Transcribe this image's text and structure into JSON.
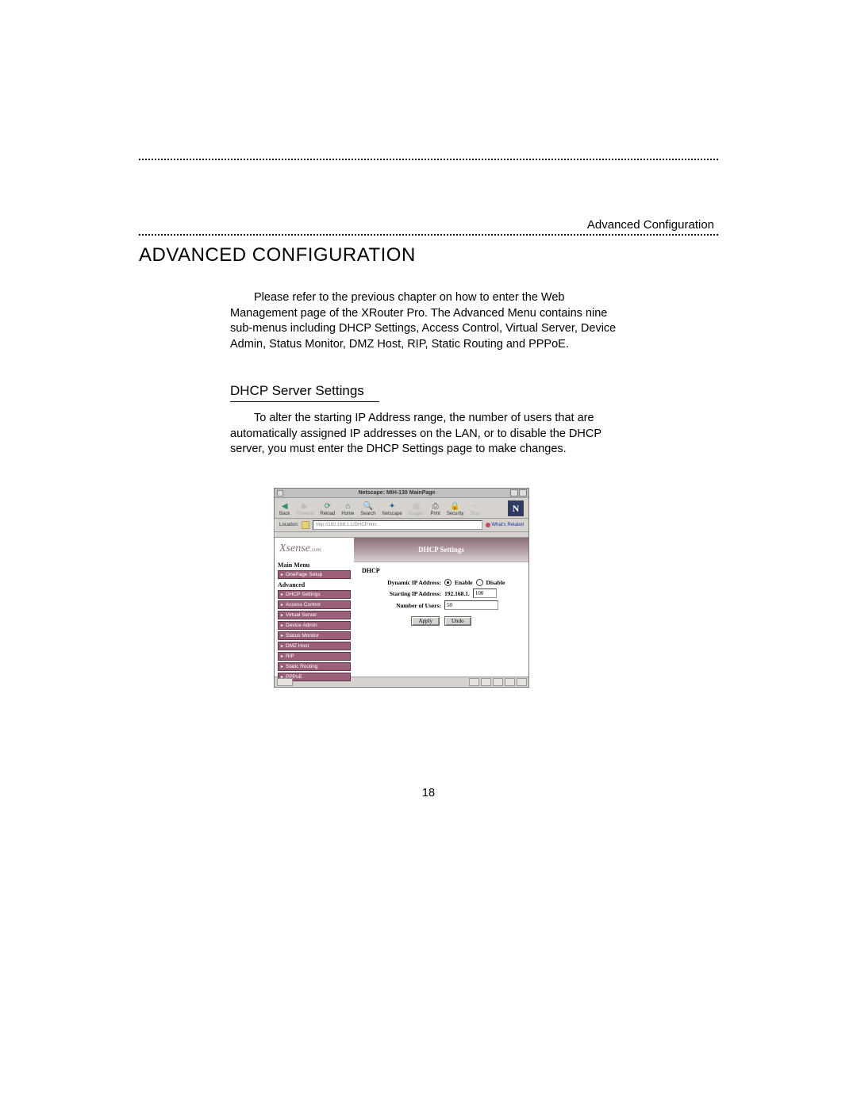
{
  "running_header": "Advanced Configuration",
  "chapter_title": "ADVANCED CONFIGURATION",
  "intro_paragraph": "Please refer to the previous chapter on how to enter the Web Management page of the XRouter Pro. The Advanced Menu contains nine sub-menus including DHCP Settings, Access Control, Virtual Server, Device Admin,  Status Monitor, DMZ Host, RIP, Static Routing and PPPoE.",
  "section_heading": "DHCP Server Settings",
  "section_paragraph": "To alter the starting IP Address range, the number of users that are automatically assigned IP addresses on the LAN, or to disable the DHCP server,  you must enter the DHCP Settings page to make changes.",
  "page_number": "18",
  "netscape": {
    "window_title": "Netscape: MIH-130 MainPage",
    "toolbar": {
      "back": "Back",
      "forward": "Forward",
      "reload": "Reload",
      "home": "Home",
      "search": "Search",
      "netscape": "Netscape",
      "images": "Images",
      "print": "Print",
      "security": "Security",
      "stop": "Stop"
    },
    "location_label": "Location:",
    "location_value": "http://192.168.1.1/DHCP.htm",
    "whats_related": "What's Related",
    "brand": "Xsense",
    "brand_suffix": ".com",
    "menu_header": "Main Menu",
    "menu_onepage": "OnePage Setup",
    "advanced_header": "Advanced",
    "menu_items": {
      "dhcp_settings": "DHCP Settings",
      "access_control": "Access Control",
      "virtual_server": "Virtual Server",
      "device_admin": "Device Admin",
      "status_monitor": "Status Monitor",
      "dmz_host": "DMZ Host",
      "rip": "RIP",
      "static_routing": "Static Routing",
      "pppoe": "PPPoE"
    },
    "banner": "DHCP Settings",
    "form": {
      "section_label": "DHCP",
      "dynamic_label": "Dynamic IP Address:",
      "enable": "Enable",
      "disable": "Disable",
      "starting_label": "Starting IP Address:",
      "ip_prefix": "192.168.1.",
      "ip_suffix": "100",
      "users_label": "Number of Users:",
      "users_value": "50",
      "apply": "Apply",
      "undo": "Undo"
    }
  }
}
